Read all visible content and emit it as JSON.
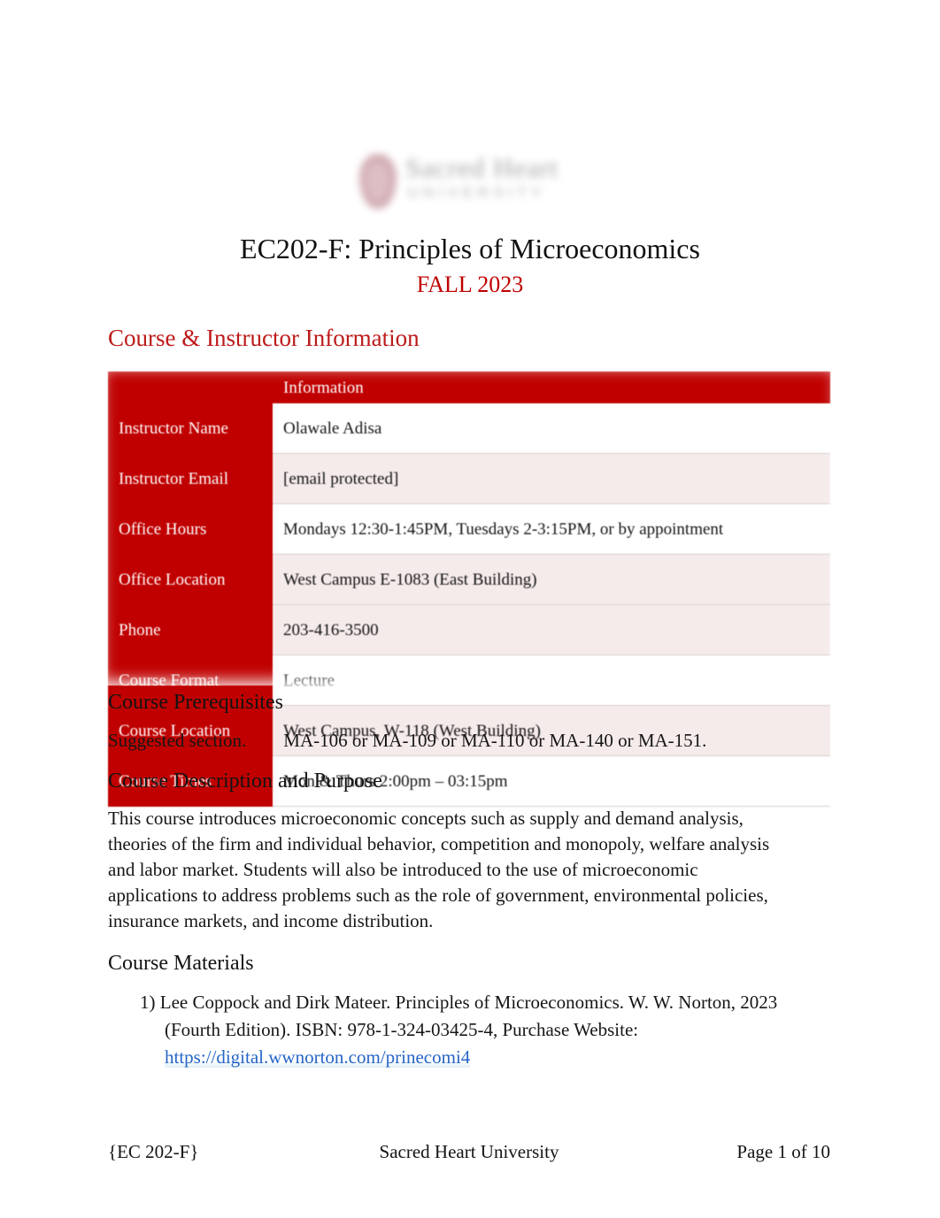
{
  "logo": {
    "name": "Sacred Heart",
    "subtitle": "UNIVERSITY",
    "shield_color": "#a15360"
  },
  "title": "EC202-F: Principles of Microeconomics",
  "subtitle": "FALL 2023",
  "accent_red": "#c00000",
  "heading_red": "#bd1a1a",
  "link_blue": "#2565c7",
  "sections": {
    "course_instructor_information": {
      "heading": "Course & Instructor Information",
      "table": {
        "header": {
          "label_col": "",
          "value_col": "Information"
        },
        "rows": [
          {
            "label": "Instructor Name",
            "value": "Olawale Adisa"
          },
          {
            "label": "Instructor Email",
            "value": "[email protected]"
          },
          {
            "label": "Office Hours",
            "value": "Mondays 12:30-1:45PM, Tuesdays 2-3:15PM, or by appointment"
          },
          {
            "label": "Office Location",
            "value": "West Campus E-1083 (East Building)"
          },
          {
            "label": "Phone",
            "value": "203-416-3500"
          },
          {
            "label": "Course Format",
            "value": "Lecture"
          },
          {
            "label": "Course Location",
            "value": "West Campus, W-118 (West Building)"
          },
          {
            "label": "Course Times",
            "value": "Mon & Thurs 2:00pm   – 03:15pm"
          }
        ]
      }
    },
    "course_prerequisites": {
      "heading": "Course Prerequisites",
      "text": "Suggested section.        MA-106 or MA-109 or MA-110 or MA-140 or MA-151."
    },
    "course_description": {
      "heading": "Course Description and Purpose",
      "text": "This course introduces microeconomic concepts such as supply and demand analysis, theories of the firm and individual behavior, competition and monopoly, welfare analysis and labor market. Students will also be introduced to the use of microeconomic applications to address problems such as the role of government, environmental policies, insurance markets, and income distribution."
    },
    "course_materials": {
      "heading": "Course Materials",
      "items": [
        {
          "marker": "1)",
          "text_before_link": "Lee Coppock and Dirk Mateer.     Principles of Microeconomics.     W. W. Norton, 2023 (Fourth Edition). ISBN: 978-1-324-03425-4,        Purchase Website: ",
          "link_text": "https://digital.wwnorton.com/prinecomi4"
        }
      ]
    }
  },
  "footer": {
    "left": "{EC 202-F}",
    "center": "Sacred Heart University",
    "right": "Page 1 of 10"
  }
}
